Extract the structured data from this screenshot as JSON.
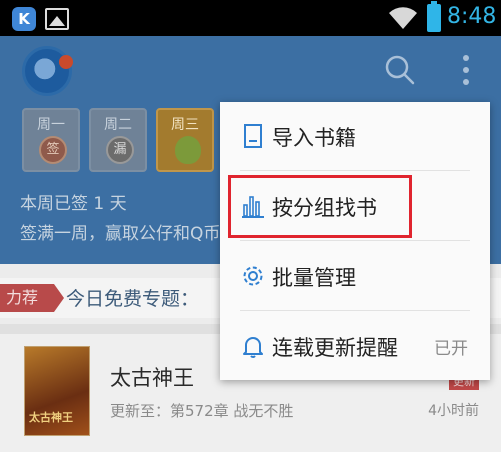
{
  "status_bar": {
    "app_icon_letter": "K",
    "time": "8:48",
    "colors": {
      "time": "#33b5e5",
      "battery": "#2fb5e8"
    }
  },
  "header": {
    "days": [
      {
        "label": "周一",
        "seal": "签",
        "state": "signed"
      },
      {
        "label": "周二",
        "seal": "漏",
        "state": "missed"
      },
      {
        "label": "周三",
        "state": "current"
      }
    ],
    "week_signed": "本周已签 1 天",
    "week_desc": "签满一周，赢取公仔和Q币"
  },
  "content": {
    "tag": "力荐",
    "free_title": "今日免费专题：",
    "book": {
      "cover_text": "太古神王",
      "title": "太古神王",
      "badge": "更新",
      "latest": "更新至：第572章 战无不胜",
      "time": "4小时前"
    }
  },
  "menu": {
    "items": [
      {
        "icon": "import-book-icon",
        "label": "导入书籍"
      },
      {
        "icon": "bar-chart-icon",
        "label": "按分组找书"
      },
      {
        "icon": "gear-icon",
        "label": "批量管理"
      },
      {
        "icon": "bell-icon",
        "label": "连载更新提醒",
        "state": "已开"
      }
    ],
    "highlight_color": "#e0242e"
  }
}
